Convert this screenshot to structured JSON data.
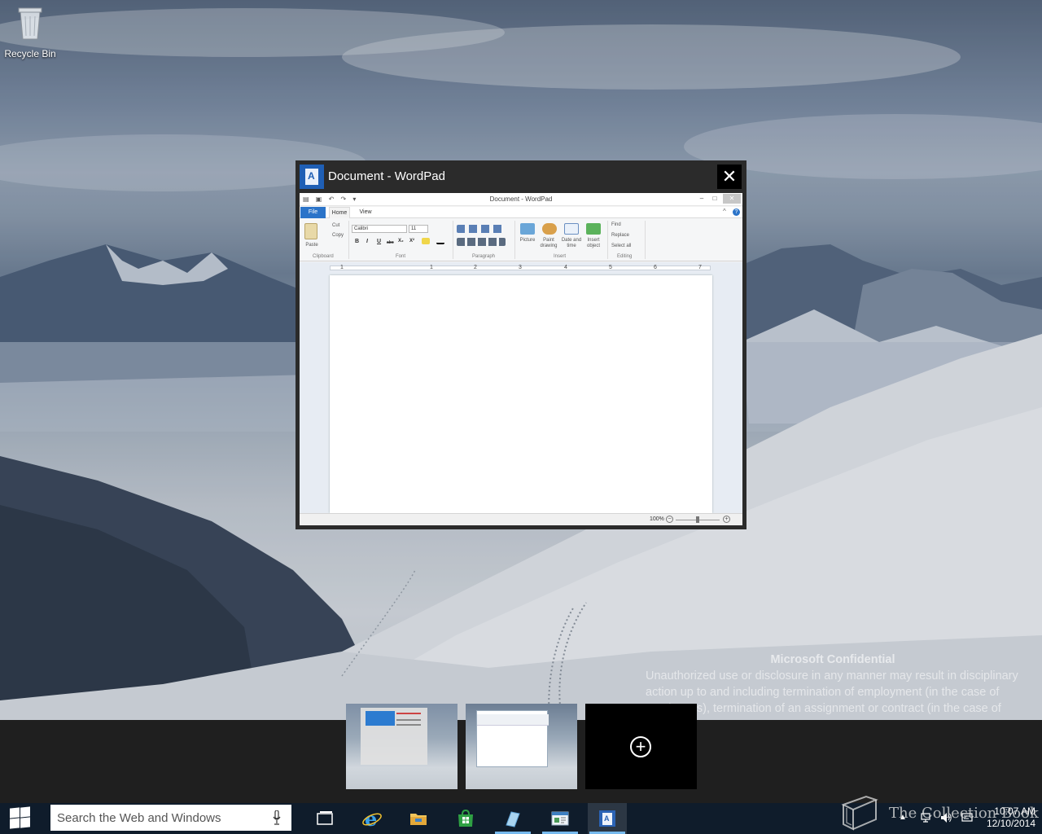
{
  "desktop": {
    "recycle_bin_label": "Recycle Bin"
  },
  "task_view": {
    "window_title": "Document - WordPad",
    "close_glyph": "✕",
    "app_icon": "wordpad-icon",
    "thumbnail": {
      "caption": "Document - WordPad",
      "tabs": [
        "File",
        "Home",
        "View"
      ],
      "clipboard": {
        "paste": "Paste",
        "cut": "Cut",
        "copy": "Copy",
        "group": "Clipboard"
      },
      "font": {
        "family": "Calibri",
        "size": "11",
        "group": "Font",
        "buttons": [
          "B",
          "I",
          "U",
          "abc",
          "X₂",
          "X²"
        ]
      },
      "paragraph_group": "Paragraph",
      "insert": {
        "picture": "Picture",
        "paint_drawing": "Paint drawing",
        "date_time": "Date and time",
        "insert_object": "Insert object",
        "group": "Insert"
      },
      "editing": {
        "find": "Find",
        "replace": "Replace",
        "select_all": "Select all",
        "group": "Editing"
      },
      "ruler_numbers": [
        "1",
        "1",
        "2",
        "3",
        "4",
        "5",
        "6",
        "7"
      ],
      "zoom": "100%"
    }
  },
  "watermark": {
    "heading": "Microsoft Confidential",
    "lines": [
      "Unauthorized use or disclosure in any manner may result in disciplinary",
      "action up to and including termination of employment (in the case of",
      "employees), termination of an assignment or contract (in the case of"
    ]
  },
  "virtual_desktops": {
    "add_glyph": "+"
  },
  "taskbar": {
    "search_placeholder": "Search the Web and Windows",
    "pinned": [
      "task-view-icon",
      "internet-explorer-icon",
      "file-explorer-icon",
      "store-icon",
      "snipping-tool-icon",
      "window-app-icon",
      "wordpad-icon"
    ],
    "clock_time": "10:07 AM",
    "clock_date": "12/10/2014"
  },
  "overlay": {
    "brand_text": "The Collection Book"
  }
}
